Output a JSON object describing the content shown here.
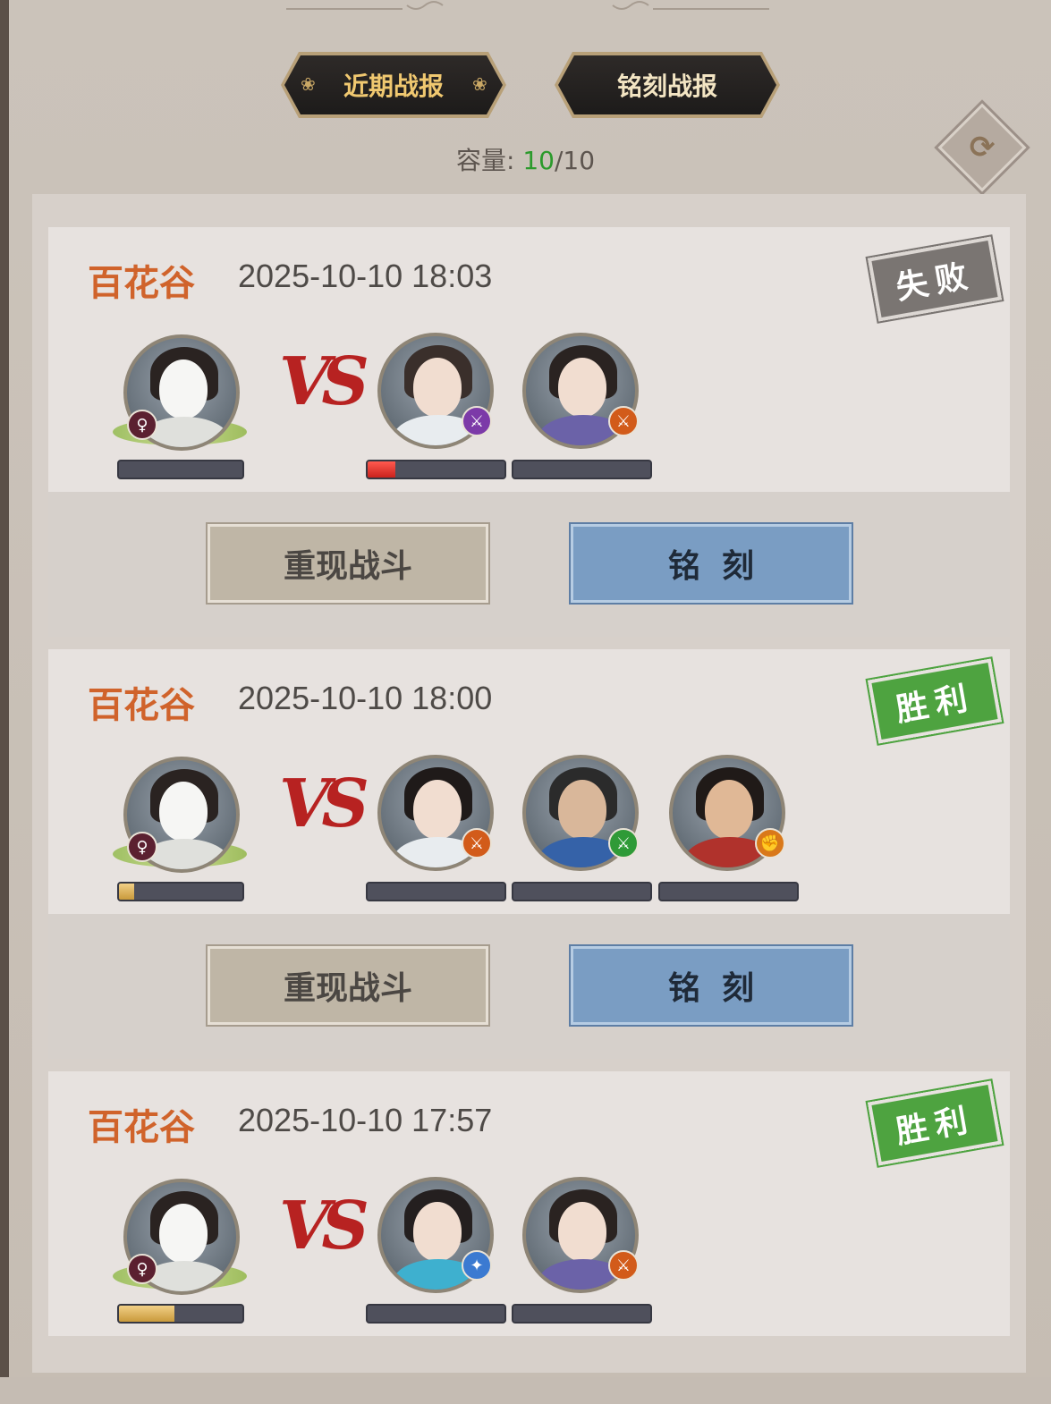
{
  "tabs": [
    {
      "label": "近期战报",
      "active": true
    },
    {
      "label": "铭刻战报",
      "active": false
    }
  ],
  "capacity": {
    "label": "容量:",
    "current": "10",
    "sep_max": "/10"
  },
  "icons": {
    "refresh": "refresh-icon"
  },
  "battles": [
    {
      "location": "百花谷",
      "time": "2025-10-10 18:03",
      "result": "失败",
      "result_type": "lose",
      "player": {
        "gender_badge": "♀",
        "hp_fraction": 0.0
      },
      "enemies": [
        {
          "badge_color": "#7c3aa8",
          "hp_fraction": 0.2,
          "robe_color": "#e8ecef",
          "hair_color": "#3a2f2b"
        },
        {
          "badge_color": "#d25b1a",
          "hp_fraction": 0.0,
          "robe_color": "#6b62a8",
          "hair_color": "#2a2321"
        }
      ],
      "buttons": {
        "replay": "重现战斗",
        "engrave": "铭刻"
      }
    },
    {
      "location": "百花谷",
      "time": "2025-10-10 18:00",
      "result": "胜利",
      "result_type": "win",
      "player": {
        "gender_badge": "♀",
        "hp_fraction": 0.12
      },
      "enemies": [
        {
          "badge_color": "#d25b1a",
          "hp_fraction": 0.0,
          "robe_color": "#e8ecef",
          "hair_color": "#1f1a19"
        },
        {
          "badge_color": "#2f9a37",
          "hp_fraction": 0.0,
          "robe_color": "#3562a8",
          "hair_color": "#2b2b2b"
        },
        {
          "badge_color": "#d9781a",
          "hp_fraction": 0.0,
          "robe_color": "#b0322c",
          "hair_color": "#201a18"
        }
      ],
      "buttons": {
        "replay": "重现战斗",
        "engrave": "铭刻"
      }
    },
    {
      "location": "百花谷",
      "time": "2025-10-10 17:57",
      "result": "胜利",
      "result_type": "win",
      "player": {
        "gender_badge": "♀",
        "hp_fraction": 0.45
      },
      "enemies": [
        {
          "badge_color": "#3b7ad1",
          "hp_fraction": 0.0,
          "robe_color": "#3eb0cf",
          "hair_color": "#241f1f"
        },
        {
          "badge_color": "#d25b1a",
          "hp_fraction": 0.0,
          "robe_color": "#6b62a8",
          "hair_color": "#2a2321"
        }
      ]
    }
  ]
}
